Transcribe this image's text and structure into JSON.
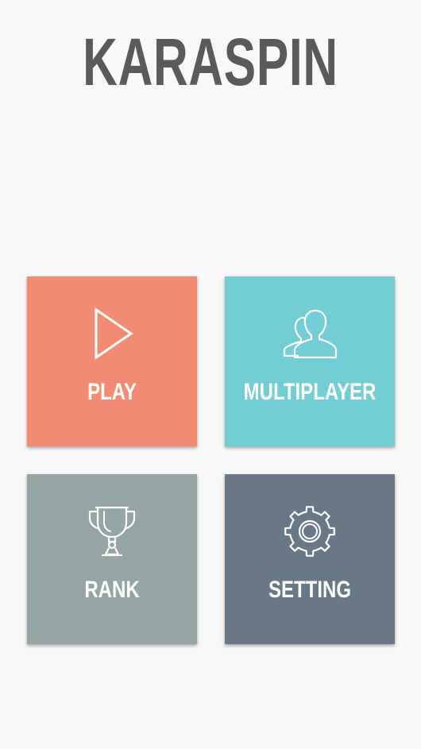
{
  "app": {
    "title": "KARASPIN"
  },
  "menu": {
    "play": {
      "label": "PLAY",
      "icon": "play-icon",
      "color": "#f28b74"
    },
    "multiplayer": {
      "label": "MULTIPLAYER",
      "icon": "users-icon",
      "color": "#73cdd5"
    },
    "rank": {
      "label": "RANK",
      "icon": "trophy-icon",
      "color": "#95a5a3"
    },
    "setting": {
      "label": "SETTING",
      "icon": "gear-icon",
      "color": "#687887"
    }
  }
}
